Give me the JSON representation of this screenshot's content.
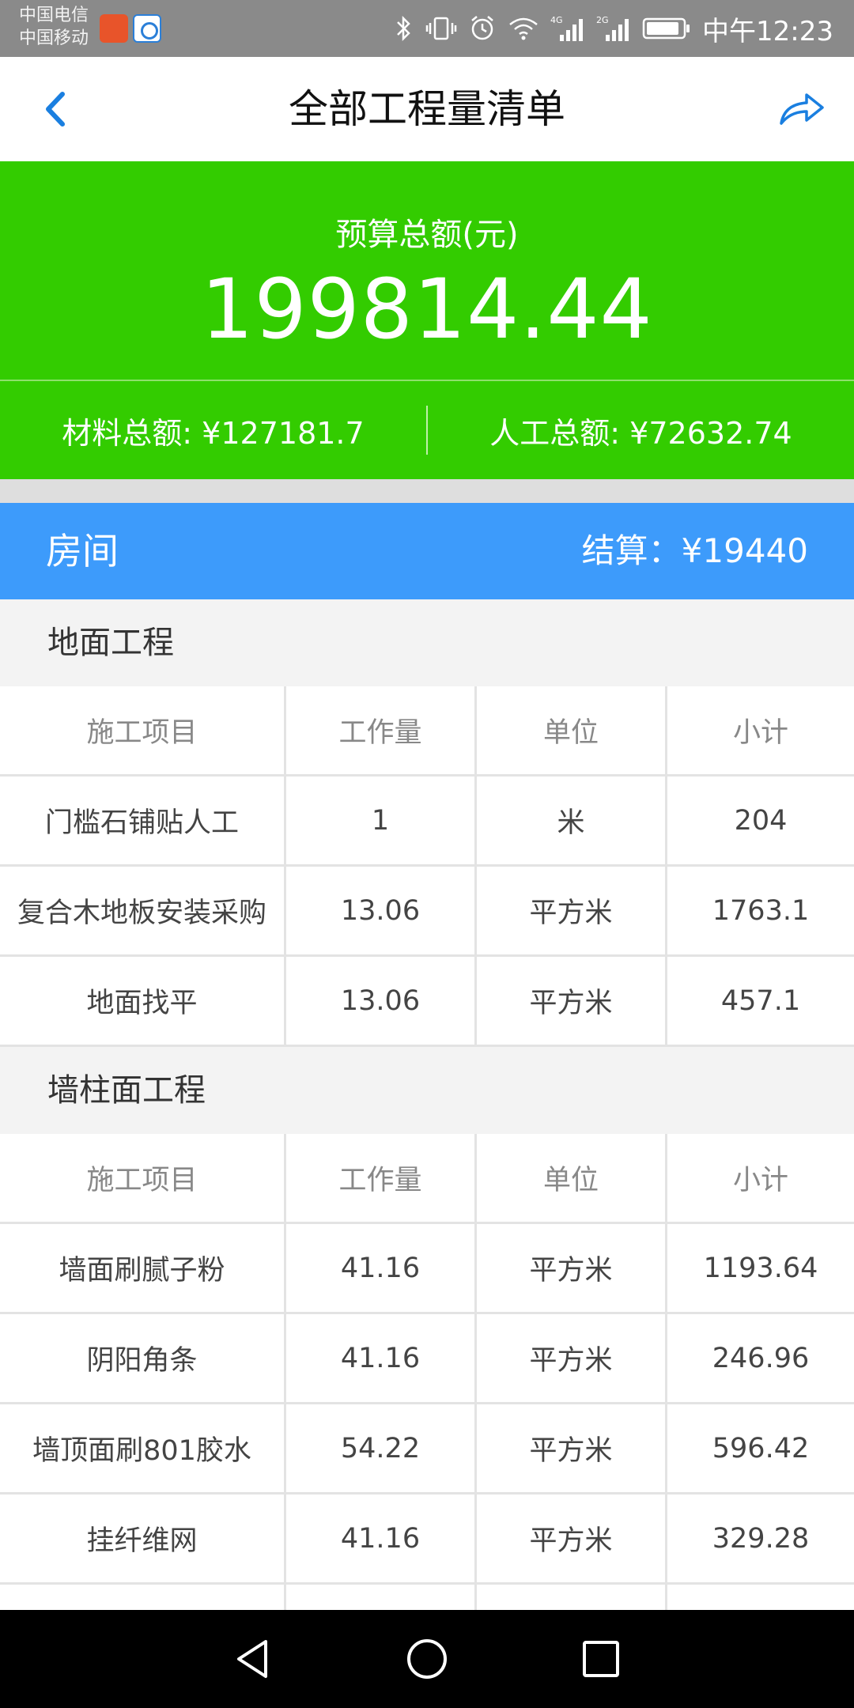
{
  "status_bar": {
    "carrier_1": "中国电信",
    "carrier_2": "中国移动",
    "network_1": "4G",
    "network_2": "2G",
    "time": "中午12:23"
  },
  "header": {
    "title": "全部工程量清单",
    "back_icon": "chevron-left-icon",
    "share_icon": "share-icon"
  },
  "budget": {
    "label": "预算总额(元)",
    "total": "199814.44",
    "material": "材料总额: ¥127181.7",
    "labor": "人工总额: ¥72632.74"
  },
  "room": {
    "name": "房间",
    "settlement": "结算：¥19440"
  },
  "sections": [
    {
      "title": "地面工程",
      "columns": [
        "施工项目",
        "工作量",
        "单位",
        "小计"
      ],
      "rows": [
        [
          "门槛石铺贴人工",
          "1",
          "米",
          "204"
        ],
        [
          "复合木地板安装采购",
          "13.06",
          "平方米",
          "1763.1"
        ],
        [
          "地面找平",
          "13.06",
          "平方米",
          "457.1"
        ]
      ]
    },
    {
      "title": "墙柱面工程",
      "columns": [
        "施工项目",
        "工作量",
        "单位",
        "小计"
      ],
      "rows": [
        [
          "墙面刷腻子粉",
          "41.16",
          "平方米",
          "1193.64"
        ],
        [
          "阴阳角条",
          "41.16",
          "平方米",
          "246.96"
        ],
        [
          "墙顶面刷801胶水",
          "54.22",
          "平方米",
          "596.42"
        ],
        [
          "挂纤维网",
          "41.16",
          "平方米",
          "329.28"
        ]
      ]
    }
  ],
  "colors": {
    "banner_green": "#33cc00",
    "room_blue": "#3d9bfb",
    "accent_blue": "#2b7fd8"
  },
  "nav_icons": [
    "back-triangle-icon",
    "home-circle-icon",
    "recents-square-icon"
  ]
}
